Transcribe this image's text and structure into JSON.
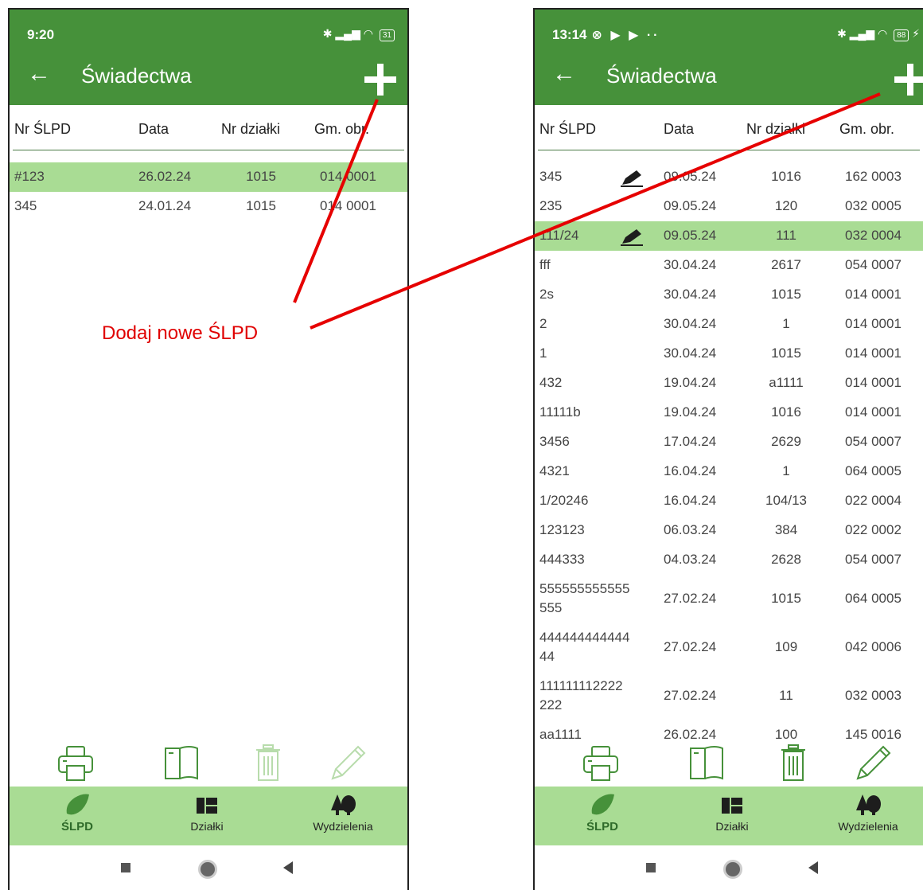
{
  "annotation": {
    "label": "Dodaj nowe ŚLPD",
    "color": "#e60000"
  },
  "colors": {
    "appbar": "#46913a",
    "selected_row": "#a9dc94",
    "nav_bg": "#a9dc94",
    "icon": "#46913a"
  },
  "columns": [
    "Nr ŚLPD",
    "Data",
    "Nr działki",
    "Gm. obr."
  ],
  "nav": {
    "slpd": "ŚLPD",
    "dzialki": "Działki",
    "wydzielenia": "Wydzielenia"
  },
  "left": {
    "status_time": "9:20",
    "battery": "31",
    "title": "Świadectwa",
    "rows": [
      {
        "nr": "#123",
        "data": "26.02.24",
        "dzialka": "1015",
        "gm": "014 0001",
        "selected": true
      },
      {
        "nr": "345",
        "data": "24.01.24",
        "dzialka": "1015",
        "gm": "014 0001"
      }
    ]
  },
  "right": {
    "status_time": "13:14",
    "status_extra": "⊗ ▶ ▶ ··",
    "battery": "88",
    "title": "Świadectwa",
    "rows": [
      {
        "nr": "345",
        "data": "09.05.24",
        "dzialka": "1016",
        "gm": "162 0003",
        "edit": true
      },
      {
        "nr": "235",
        "data": "09.05.24",
        "dzialka": "120",
        "gm": "032 0005"
      },
      {
        "nr": "111/24",
        "data": "09.05.24",
        "dzialka": "111",
        "gm": "032 0004",
        "edit": true,
        "selected": true
      },
      {
        "nr": "fff",
        "data": "30.04.24",
        "dzialka": "2617",
        "gm": "054 0007"
      },
      {
        "nr": "2s",
        "data": "30.04.24",
        "dzialka": "1015",
        "gm": "014 0001"
      },
      {
        "nr": "2",
        "data": "30.04.24",
        "dzialka": "1",
        "gm": "014 0001"
      },
      {
        "nr": "1",
        "data": "30.04.24",
        "dzialka": "1015",
        "gm": "014 0001"
      },
      {
        "nr": "432",
        "data": "19.04.24",
        "dzialka": "a1111",
        "gm": "014 0001"
      },
      {
        "nr": "11111b",
        "data": "19.04.24",
        "dzialka": "1016",
        "gm": "014 0001"
      },
      {
        "nr": "3456",
        "data": "17.04.24",
        "dzialka": "2629",
        "gm": "054 0007"
      },
      {
        "nr": "4321",
        "data": "16.04.24",
        "dzialka": "1",
        "gm": "064 0005"
      },
      {
        "nr": "1/20246",
        "data": "16.04.24",
        "dzialka": "104/13",
        "gm": "022 0004"
      },
      {
        "nr": "123123",
        "data": "06.03.24",
        "dzialka": "384",
        "gm": "022 0002"
      },
      {
        "nr": "444333",
        "data": "04.03.24",
        "dzialka": "2628",
        "gm": "054 0007"
      },
      {
        "nr": "555555555555 555",
        "data": "27.02.24",
        "dzialka": "1015",
        "gm": "064 0005"
      },
      {
        "nr": "444444444444 44",
        "data": "27.02.24",
        "dzialka": "109",
        "gm": "042 0006"
      },
      {
        "nr": "111111112222 222",
        "data": "27.02.24",
        "dzialka": "11",
        "gm": "032 0003"
      },
      {
        "nr": "aa1111",
        "data": "26.02.24",
        "dzialka": "100",
        "gm": "145 0016"
      }
    ]
  }
}
